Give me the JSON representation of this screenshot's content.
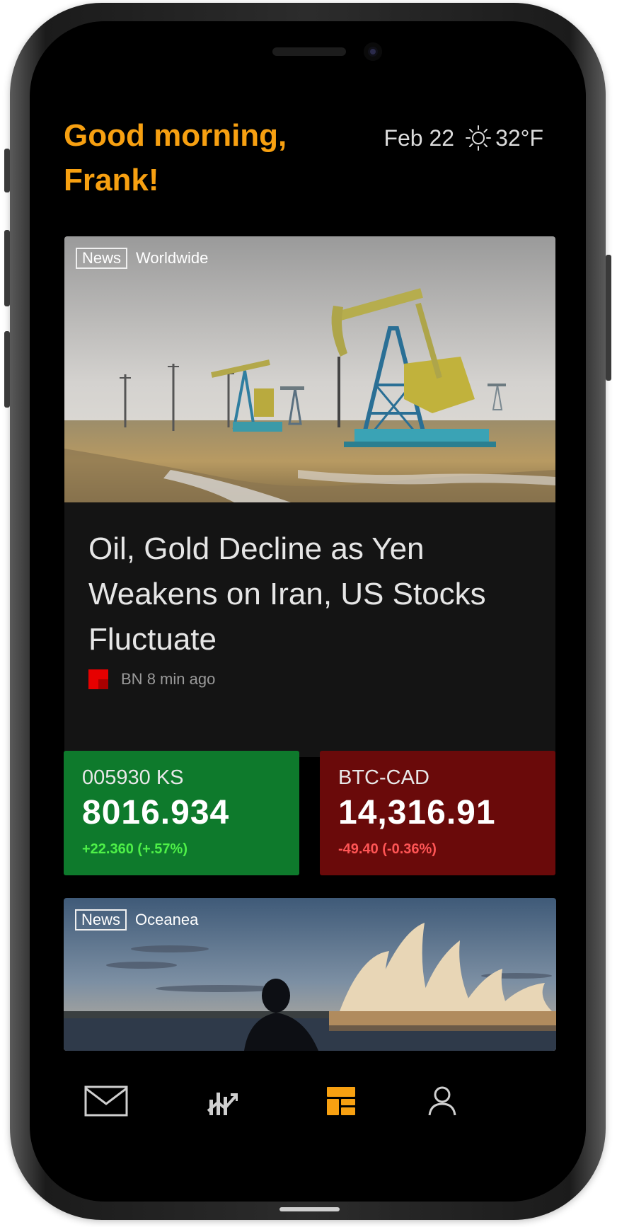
{
  "header": {
    "greeting_line1": "Good morning,",
    "greeting_line2": "Frank!",
    "date": "Feb 22",
    "weather_icon": "sun-icon",
    "temperature": "32°F"
  },
  "featured_news": {
    "tag": "News",
    "region": "Worldwide",
    "image": "oil-pumpjacks-field",
    "title": "Oil, Gold Decline as Yen Weakens on Iran, US Stocks Fluctuate",
    "source": "BN",
    "time_ago": "8 min ago"
  },
  "tickers": [
    {
      "symbol": "005930 KS",
      "price": "8016.934",
      "change": "+22.360 (+.57%)",
      "direction": "up",
      "color": "#0e7a2c"
    },
    {
      "symbol": "BTC-CAD",
      "price": "14,316.91",
      "change": "-49.40 (-0.36%)",
      "direction": "down",
      "color": "#6a0a0a"
    }
  ],
  "second_news": {
    "tag": "News",
    "region": "Oceanea",
    "image": "sydney-opera-house-sunset"
  },
  "nav": {
    "items": [
      {
        "icon": "mail-icon",
        "active": false
      },
      {
        "icon": "chart-icon",
        "active": false
      },
      {
        "icon": "dashboard-icon",
        "active": true
      },
      {
        "icon": "profile-icon",
        "active": false
      }
    ],
    "active_color": "#f7a011",
    "inactive_color": "#cfcfcf"
  },
  "colors": {
    "accent": "#f7a011",
    "background": "#000000",
    "card": "#141414"
  }
}
